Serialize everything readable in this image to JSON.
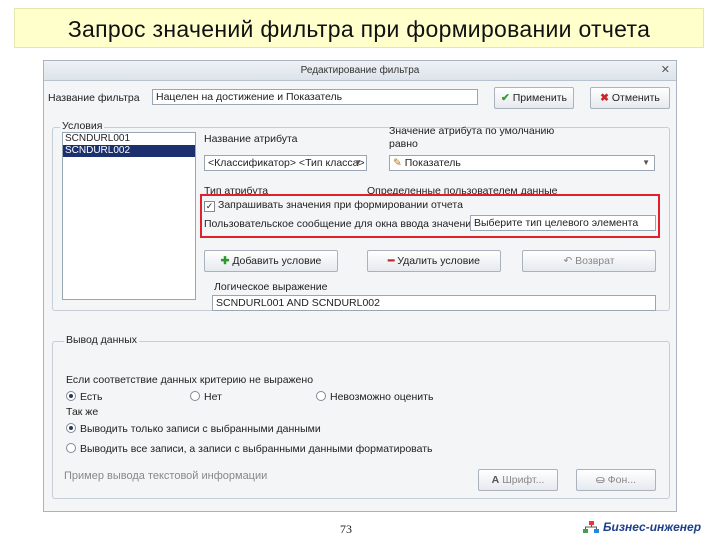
{
  "slide": {
    "title": "Запрос значений фильтра при формировании отчета",
    "page_number": "73",
    "brand": "Бизнес-инженер"
  },
  "dialog": {
    "title": "Редактирование фильтра",
    "filter_name_label": "Название фильтра",
    "filter_name_value": "Нацелен на достижение и Показатель",
    "apply_button": "Применить",
    "cancel_button": "Отменить",
    "conditions": {
      "legend": "Условия",
      "list_items": [
        "SCNDURL001",
        "SCNDURL002"
      ],
      "selected_index": 1,
      "attribute_name_label": "Название атрибута",
      "attribute_name_value": "<Классификатор> <Тип класса>",
      "attribute_value_label": "Значение атрибута по умолчанию",
      "attribute_value_label_2": "равно",
      "attribute_value_value": "Показатель",
      "attribute_type_label": "Тип атрибута",
      "user_defined_label": "Определенные пользователем данные",
      "request_values_checkbox": "Запрашивать значения при формировании отчета",
      "request_values_checked": true,
      "user_prompt_label": "Пользовательское сообщение для окна ввода значения",
      "user_prompt_value": "Выберите тип целевого элемента",
      "add_condition_button": "Добавить условие",
      "delete_condition_button": "Удалить условие",
      "revert_button": "Возврат",
      "logical_expression_label": "Логическое выражение",
      "logical_expression_value": "SCNDURL001 AND SCNDURL002"
    },
    "output": {
      "legend": "Вывод данных",
      "no_match_label": "Если соответствие данных критерию не выражено",
      "no_match_options": [
        "Есть",
        "Нет",
        "Невозможно оценить"
      ],
      "no_match_selected": 0,
      "also_label": "Так же",
      "records_options": [
        "Выводить только записи с выбранными данными",
        "Выводить все записи, а записи с выбранными данными форматировать"
      ],
      "records_selected": 0,
      "example_label": "Пример вывода текстовой информации",
      "font_button": "Шрифт...",
      "background_button": "Фон..."
    }
  }
}
